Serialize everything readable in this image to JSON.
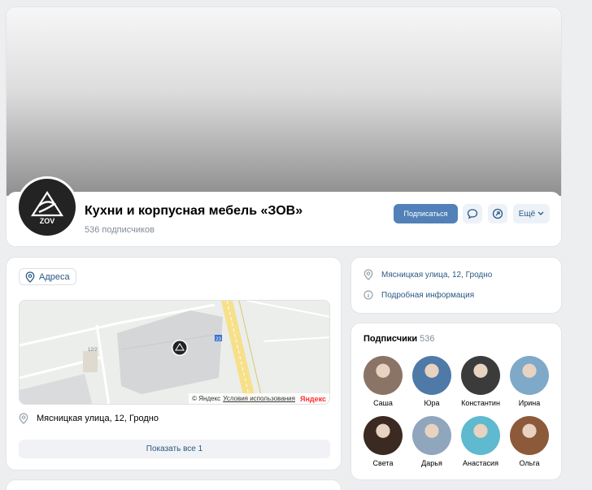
{
  "group": {
    "name": "Кухни и корпусная мебель «ЗОВ»",
    "subscribers_text": "536 подписчиков",
    "logo_text": "ZOV"
  },
  "actions": {
    "subscribe_label": "Подписаться",
    "message_icon": "message-icon",
    "share_icon": "share-icon",
    "more_label": "Ещё"
  },
  "addresses": {
    "chip_label": "Адреса",
    "map": {
      "copyright": "© Яндекс",
      "terms_link": "Условия использования",
      "brand": "Яндекс",
      "house_number": "12/2",
      "road_marker": "23"
    },
    "address_line": "Мясницкая улица, 12, Гродно",
    "show_all_label": "Показать все 1"
  },
  "info": {
    "address": "Мясницкая улица, 12, Гродно",
    "details_link": "Подробная информация"
  },
  "subscribers": {
    "title": "Подписчики",
    "count": "536",
    "people": [
      {
        "name": "Саша",
        "color": "#8a7466"
      },
      {
        "name": "Юра",
        "color": "#4f7aa8"
      },
      {
        "name": "Константин",
        "color": "#3b3b3b"
      },
      {
        "name": "Ирина",
        "color": "#7fa9c9"
      },
      {
        "name": "Света",
        "color": "#3a2a22"
      },
      {
        "name": "Дарья",
        "color": "#8fa6bd"
      },
      {
        "name": "Анастасия",
        "color": "#5fb9cf"
      },
      {
        "name": "Ольга",
        "color": "#8c5a3a"
      }
    ]
  },
  "colors": {
    "accent": "#5181b8",
    "link": "#2a5885",
    "background": "#edeef0"
  }
}
